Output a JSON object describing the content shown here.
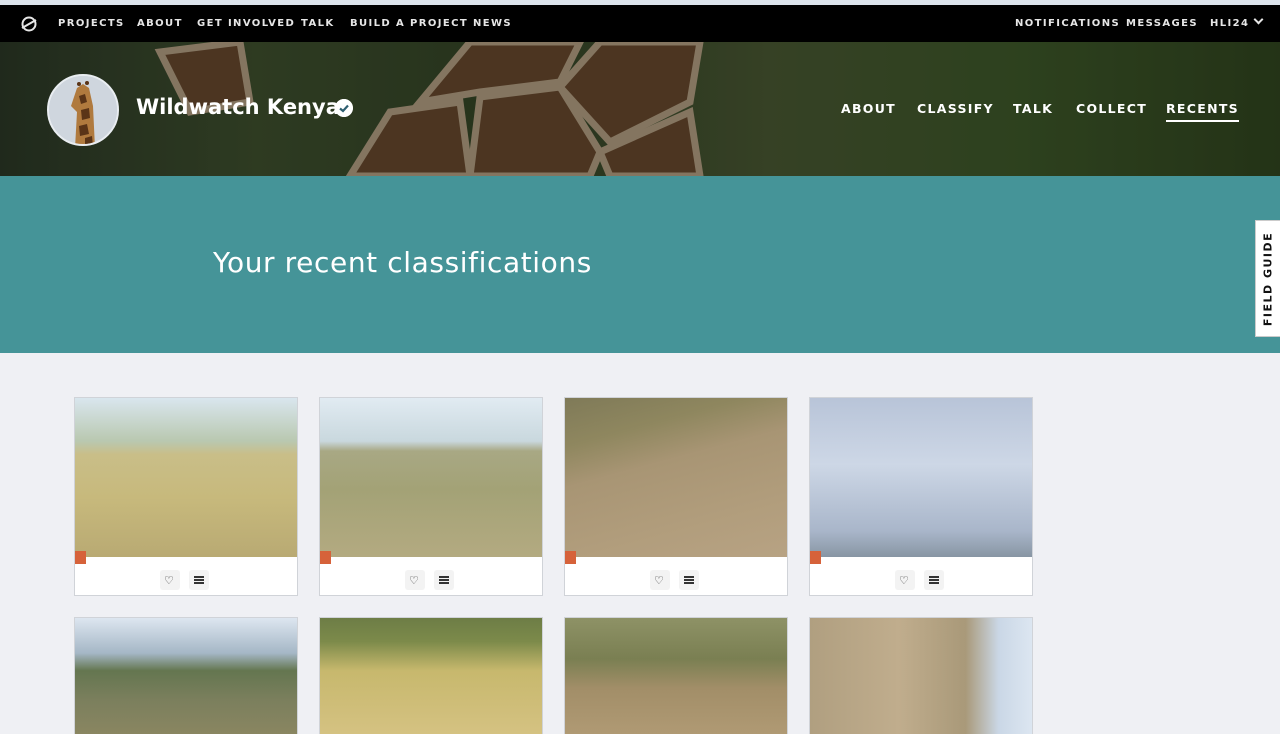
{
  "colors": {
    "banner": "#459498",
    "topnav": "#000000",
    "background": "#eff0f4",
    "tag": "#d6623a"
  },
  "topnav": {
    "logo_icon": "zooniverse-logo-icon",
    "links": [
      "PROJECTS",
      "ABOUT",
      "GET INVOLVED",
      "TALK",
      "BUILD A PROJECT",
      "NEWS"
    ],
    "right": [
      "NOTIFICATIONS",
      "MESSAGES"
    ],
    "user": "HLI24"
  },
  "project": {
    "title": "Wildwatch Kenya",
    "verified_icon": "verified-check-icon",
    "avatar_icon": "giraffe-avatar",
    "nav": [
      "ABOUT",
      "CLASSIFY",
      "TALK",
      "COLLECT",
      "RECENTS"
    ],
    "active_nav": "RECENTS"
  },
  "banner": {
    "heading": "Your recent classifications"
  },
  "field_guide": {
    "label": "FIELD GUIDE"
  },
  "cards": {
    "count_visible": 8,
    "action_icons": [
      "heart-icon",
      "collection-list-icon"
    ],
    "thumbnails": [
      "savanna-grassland",
      "savanna-plain",
      "hillside-slope",
      "sky-clouds",
      "bushland",
      "tall-yellow-grass",
      "acacia-scrub",
      "tilted-hillside"
    ]
  }
}
